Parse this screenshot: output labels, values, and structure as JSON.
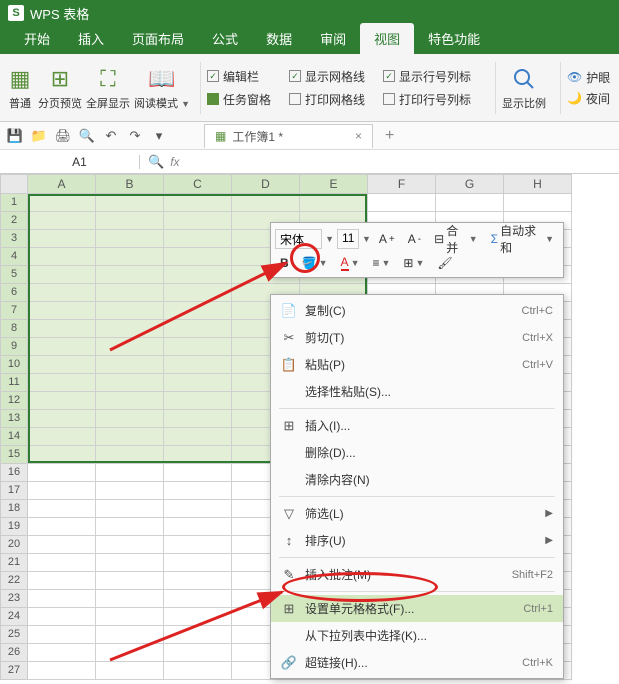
{
  "app": {
    "title": "WPS 表格"
  },
  "tabs": [
    "开始",
    "插入",
    "页面布局",
    "公式",
    "数据",
    "审阅",
    "视图",
    "特色功能"
  ],
  "activeTab": 6,
  "ribbon": {
    "views": [
      {
        "label": "普通",
        "icon": "grid-icon"
      },
      {
        "label": "分页预览",
        "icon": "page-break-icon"
      },
      {
        "label": "全屏显示",
        "icon": "fullscreen-icon"
      },
      {
        "label": "阅读模式",
        "icon": "read-mode-icon",
        "dd": true
      }
    ],
    "checks1": [
      {
        "label": "编辑栏",
        "checked": true
      },
      {
        "label": "任务窗格",
        "checked": false,
        "swatch": "#5a8f3c"
      }
    ],
    "checks2": [
      {
        "label": "显示网格线",
        "checked": true
      },
      {
        "label": "打印网格线",
        "checked": false
      }
    ],
    "checks3": [
      {
        "label": "显示行号列标",
        "checked": true
      },
      {
        "label": "打印行号列标",
        "checked": false
      }
    ],
    "zoom": {
      "label": "显示比例"
    },
    "right": [
      {
        "label": "护眼",
        "icon": "eye-icon",
        "color": "#3a7cc7"
      },
      {
        "label": "夜间",
        "icon": "moon-icon",
        "color": "#d6a838"
      }
    ]
  },
  "qat": {
    "doc": {
      "name": "工作簿1 *"
    }
  },
  "namebox": "A1",
  "fx_label": "fx",
  "cols": [
    "A",
    "B",
    "C",
    "D",
    "E",
    "F",
    "G",
    "H"
  ],
  "rowCount": 27,
  "selCols": 5,
  "selRows": 15,
  "minitoolbar": {
    "font": "宋体",
    "size": "11",
    "mergeLabel": "合并",
    "sumLabel": "自动求和"
  },
  "ctx": [
    {
      "icon": "📄",
      "label": "复制(C)",
      "shortcut": "Ctrl+C"
    },
    {
      "icon": "✂",
      "label": "剪切(T)",
      "shortcut": "Ctrl+X"
    },
    {
      "icon": "📋",
      "label": "粘贴(P)",
      "shortcut": "Ctrl+V"
    },
    {
      "icon": "",
      "label": "选择性粘贴(S)...",
      "shortcut": ""
    },
    {
      "sep": true
    },
    {
      "icon": "⊞",
      "label": "插入(I)...",
      "shortcut": ""
    },
    {
      "icon": "",
      "label": "删除(D)...",
      "shortcut": ""
    },
    {
      "icon": "",
      "label": "清除内容(N)",
      "shortcut": ""
    },
    {
      "sep": true
    },
    {
      "icon": "▽",
      "label": "筛选(L)",
      "shortcut": "",
      "sub": true
    },
    {
      "icon": "↕",
      "label": "排序(U)",
      "shortcut": "",
      "sub": true
    },
    {
      "sep": true
    },
    {
      "icon": "✎",
      "label": "插入批注(M)",
      "shortcut": "Shift+F2"
    },
    {
      "sep": true
    },
    {
      "icon": "⊞",
      "label": "设置单元格格式(F)...",
      "shortcut": "Ctrl+1",
      "hl": true
    },
    {
      "icon": "",
      "label": "从下拉列表中选择(K)...",
      "shortcut": ""
    },
    {
      "icon": "🔗",
      "label": "超链接(H)...",
      "shortcut": "Ctrl+K"
    }
  ]
}
